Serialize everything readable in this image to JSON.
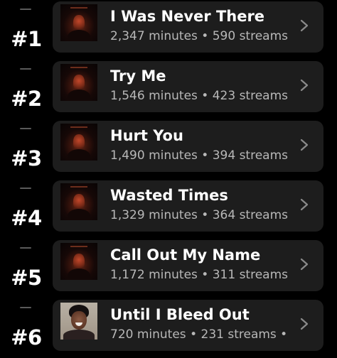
{
  "tracks": [
    {
      "rank": "#1",
      "title": "I Was Never There",
      "stats": "2,347 minutes • 590 streams",
      "album_art": "dark-red-portrait-cover"
    },
    {
      "rank": "#2",
      "title": "Try Me",
      "stats": "1,546 minutes • 423 streams",
      "album_art": "dark-red-portrait-cover"
    },
    {
      "rank": "#3",
      "title": "Hurt You",
      "stats": "1,490 minutes • 394 streams",
      "album_art": "dark-red-portrait-cover"
    },
    {
      "rank": "#4",
      "title": "Wasted Times",
      "stats": "1,329 minutes • 364 streams",
      "album_art": "dark-red-portrait-cover"
    },
    {
      "rank": "#5",
      "title": "Call Out My Name",
      "stats": "1,172 minutes • 311 streams •",
      "album_art": "dark-red-portrait-cover"
    },
    {
      "rank": "#6",
      "title": "Until I Bleed Out",
      "stats": "720 minutes • 231 streams •",
      "album_art": "smiling-portrait-cover"
    }
  ],
  "icons": {
    "trend": "dash-icon",
    "open": "chevron-right-icon"
  },
  "colors": {
    "background": "#000000",
    "card": "#1d1d1d",
    "primary_text": "#ffffff",
    "secondary_text": "#b8b8b8",
    "chevron": "#8a8a8a"
  }
}
